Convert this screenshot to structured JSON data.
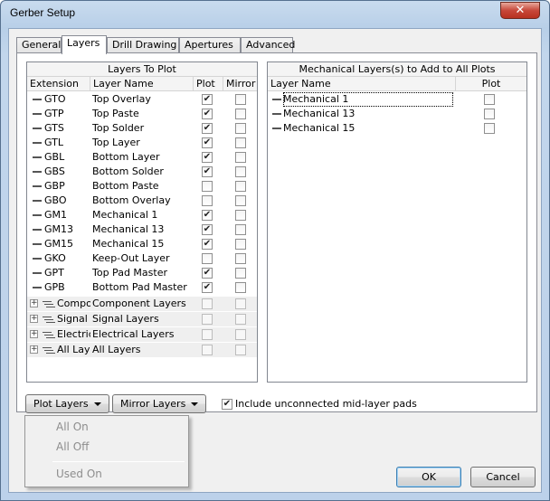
{
  "window": {
    "title": "Gerber Setup",
    "close_glyph": "✕"
  },
  "tabs": [
    "General",
    "Layers",
    "Drill Drawing",
    "Apertures",
    "Advanced"
  ],
  "layers_to_plot": {
    "header": "Layers To Plot",
    "columns": [
      "Extension",
      "Layer Name",
      "Plot",
      "Mirror"
    ],
    "rows": [
      {
        "ext": "GTO",
        "name": "Top Overlay",
        "plot": true,
        "mirror": false
      },
      {
        "ext": "GTP",
        "name": "Top Paste",
        "plot": true,
        "mirror": false
      },
      {
        "ext": "GTS",
        "name": "Top Solder",
        "plot": true,
        "mirror": false
      },
      {
        "ext": "GTL",
        "name": "Top Layer",
        "plot": true,
        "mirror": false
      },
      {
        "ext": "GBL",
        "name": "Bottom Layer",
        "plot": true,
        "mirror": false
      },
      {
        "ext": "GBS",
        "name": "Bottom Solder",
        "plot": true,
        "mirror": false
      },
      {
        "ext": "GBP",
        "name": "Bottom Paste",
        "plot": false,
        "mirror": false
      },
      {
        "ext": "GBO",
        "name": "Bottom Overlay",
        "plot": false,
        "mirror": false
      },
      {
        "ext": "GM1",
        "name": "Mechanical 1",
        "plot": true,
        "mirror": false
      },
      {
        "ext": "GM13",
        "name": "Mechanical 13",
        "plot": true,
        "mirror": false
      },
      {
        "ext": "GM15",
        "name": "Mechanical 15",
        "plot": true,
        "mirror": false
      },
      {
        "ext": "GKO",
        "name": "Keep-Out Layer",
        "plot": false,
        "mirror": false
      },
      {
        "ext": "GPT",
        "name": "Top Pad Master",
        "plot": true,
        "mirror": false
      },
      {
        "ext": "GPB",
        "name": "Bottom Pad Master",
        "plot": true,
        "mirror": false
      }
    ],
    "groups": [
      {
        "ext": "Compo",
        "name": "Component Layers"
      },
      {
        "ext": "Signal",
        "name": "Signal Layers"
      },
      {
        "ext": "Electric",
        "name": "Electrical Layers"
      },
      {
        "ext": "All Laye",
        "name": "All Layers"
      }
    ]
  },
  "mechanical": {
    "header": "Mechanical Layers(s) to Add to All Plots",
    "columns": [
      "Layer Name",
      "Plot"
    ],
    "rows": [
      {
        "name": "Mechanical 1",
        "plot": false
      },
      {
        "name": "Mechanical 13",
        "plot": false
      },
      {
        "name": "Mechanical 15",
        "plot": false
      }
    ]
  },
  "controls": {
    "plot_layers": "Plot Layers",
    "mirror_layers": "Mirror Layers",
    "include_unconnected": "Include unconnected mid-layer pads",
    "include_unconnected_checked": true
  },
  "menu": {
    "items": [
      "All On",
      "All Off",
      "Used On"
    ]
  },
  "buttons": {
    "ok": "OK",
    "cancel": "Cancel"
  },
  "icons": {
    "check": "✔",
    "plus": "+"
  }
}
